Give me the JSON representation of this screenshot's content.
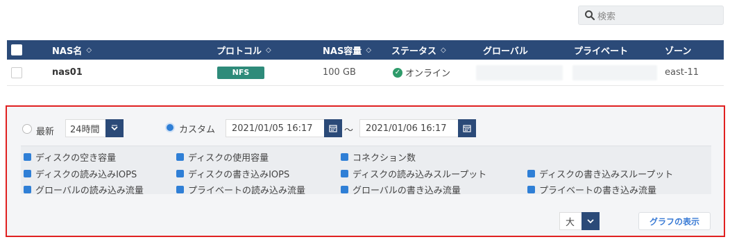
{
  "search": {
    "placeholder": "検索"
  },
  "table": {
    "headers": {
      "name": "NAS名",
      "protocol": "プロトコル",
      "capacity": "NAS容量",
      "status": "ステータス",
      "global": "グローバル",
      "private": "プライベート",
      "zone": "ゾーン"
    },
    "rows": [
      {
        "name": "nas01",
        "protocol": "NFS",
        "capacity": "100 GB",
        "status": "オンライン",
        "zone": "east-11"
      }
    ]
  },
  "filter": {
    "latest_label": "最新",
    "latest_period": "24時間",
    "custom_label": "カスタム",
    "date_from": "2021/01/05 16:17",
    "separator": "～",
    "date_to": "2021/01/06 16:17",
    "metrics": [
      "ディスクの空き容量",
      "ディスクの使用容量",
      "コネクション数",
      "ディスクの読み込みIOPS",
      "ディスクの書き込みIOPS",
      "ディスクの読み込みスループット",
      "ディスクの書き込みスループット",
      "グローバルの読み込み流量",
      "プライベートの読み込み流量",
      "グローバルの書き込み流量",
      "プライベートの書き込み流量"
    ],
    "size": "大",
    "show_button": "グラフの表示"
  },
  "colors": {
    "header_bg": "#2b4a78",
    "accent": "#2f7fd6",
    "badge": "#2e8b7a",
    "highlight_border": "#e02020"
  },
  "icons": [
    "search-icon",
    "sort-icon",
    "check-circle-icon",
    "calendar-icon",
    "chevron-down-icon"
  ]
}
